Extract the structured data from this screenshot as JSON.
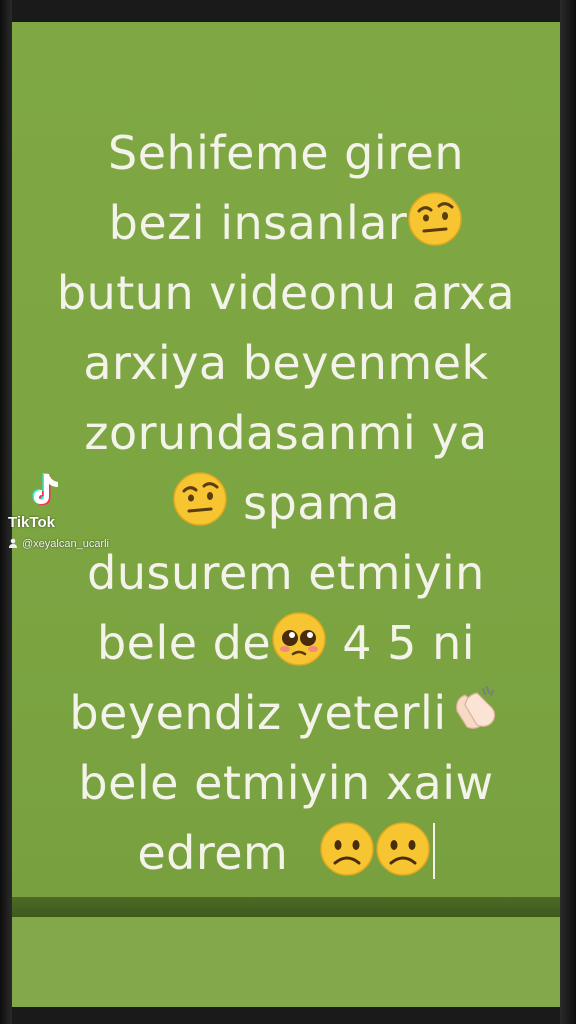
{
  "message": {
    "line1": "Sehifeme giren",
    "line2": "bezi insanlar",
    "line3": "butun videonu arxa",
    "line4": "arxiya beyenmek",
    "line5": "zorundasanmi ya",
    "line6": "spama",
    "line7": "dusurem etmiyin",
    "line8a": "bele de",
    "line8b": "4 5 ni",
    "line9": "beyendiz  yeterli",
    "line10": "bele etmiyin xaiw",
    "line11": "edrem"
  },
  "emojis": [
    "raised-eyebrow-emoji",
    "raised-eyebrow-emoji",
    "pleading-face-emoji",
    "clapping-hands-emoji",
    "frowning-face-emoji",
    "frowning-face-emoji"
  ],
  "watermark": {
    "brand": "TikTok",
    "username": "@xeyalcan_ucarli"
  },
  "colors": {
    "card_green": "#7aa33f",
    "text": "#f3f3ea"
  }
}
